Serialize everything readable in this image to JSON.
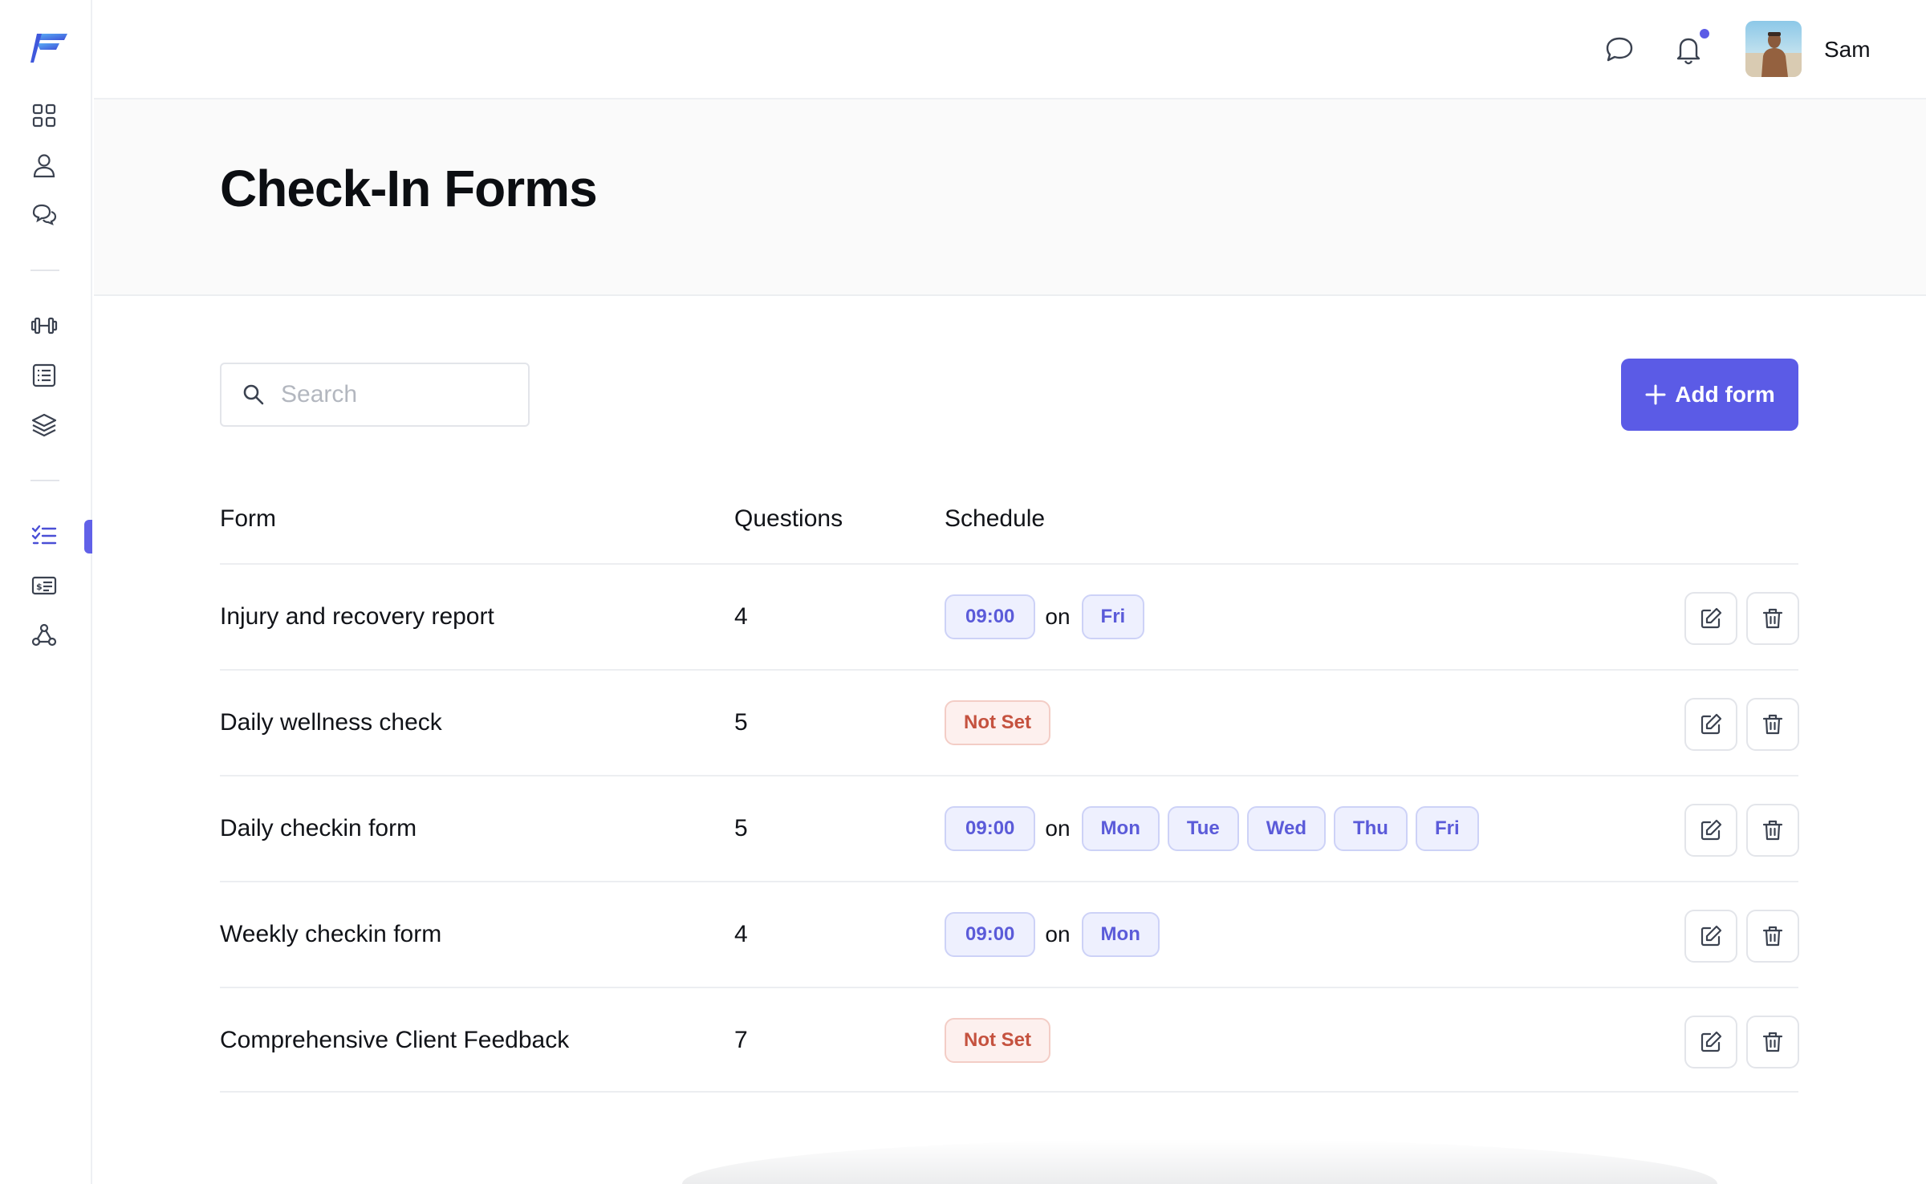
{
  "app": {
    "brand_color": "#5b5be6"
  },
  "sidebar": {
    "items": [
      {
        "icon": "grid-icon",
        "name": "dashboard"
      },
      {
        "icon": "user-icon",
        "name": "clients"
      },
      {
        "icon": "chat-icon",
        "name": "messages"
      },
      {
        "icon": "dumbbell-icon",
        "name": "workouts"
      },
      {
        "icon": "list-icon",
        "name": "programs"
      },
      {
        "icon": "layers-icon",
        "name": "library"
      },
      {
        "icon": "checklist-icon",
        "name": "check-in-forms",
        "active": true
      },
      {
        "icon": "billing-icon",
        "name": "payments"
      },
      {
        "icon": "webhook-icon",
        "name": "integrations"
      }
    ]
  },
  "header": {
    "user_name": "Sam",
    "has_notifications": true
  },
  "page": {
    "title": "Check-In Forms"
  },
  "search": {
    "placeholder": "Search",
    "value": ""
  },
  "toolbar": {
    "add_label": "Add form"
  },
  "table": {
    "headers": {
      "form": "Form",
      "questions": "Questions",
      "schedule": "Schedule"
    },
    "on_label": "on",
    "rows": [
      {
        "name": "Injury and recovery report",
        "questions": "4",
        "time": "09:00",
        "days": [
          "Fri"
        ]
      },
      {
        "name": "Daily wellness check",
        "questions": "5",
        "not_set": "Not Set"
      },
      {
        "name": "Daily checkin form",
        "questions": "5",
        "time": "09:00",
        "days": [
          "Mon",
          "Tue",
          "Wed",
          "Thu",
          "Fri"
        ]
      },
      {
        "name": "Weekly checkin form",
        "questions": "4",
        "time": "09:00",
        "days": [
          "Mon"
        ]
      },
      {
        "name": "Comprehensive Client Feedback",
        "questions": "7",
        "not_set": "Not Set"
      }
    ]
  }
}
